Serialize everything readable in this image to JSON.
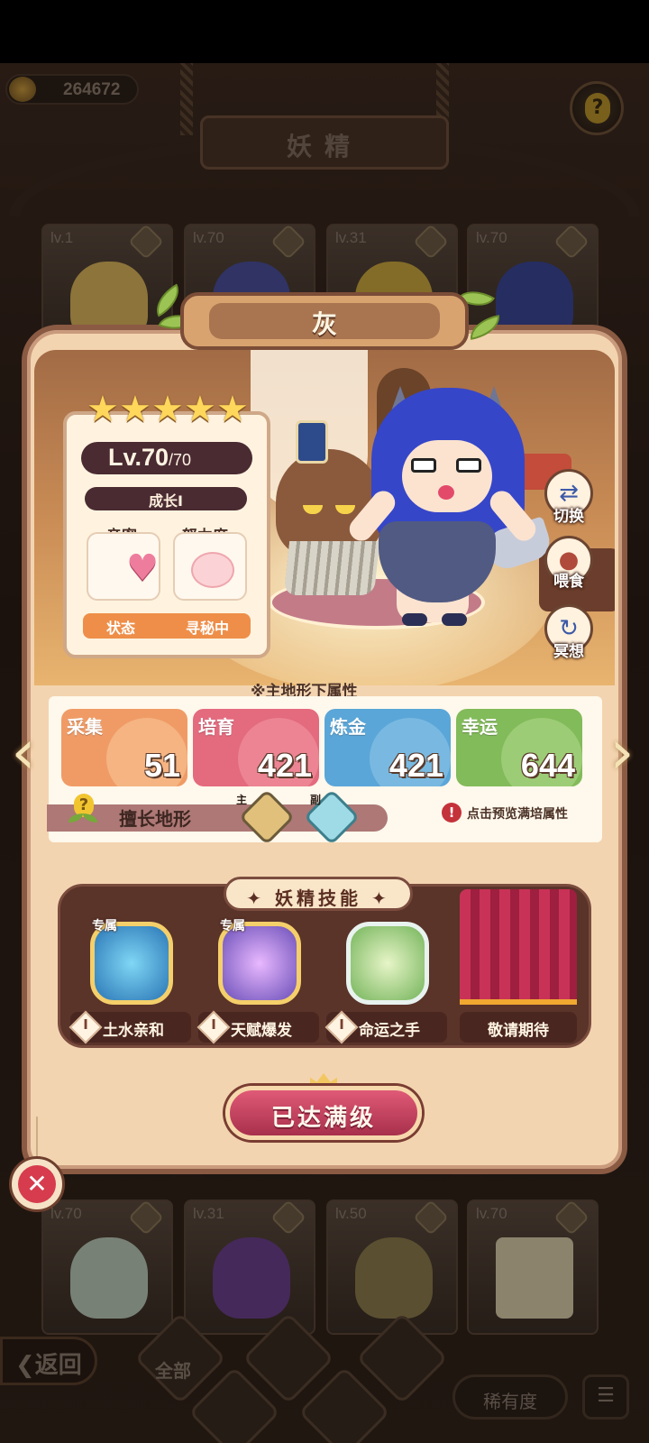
{
  "topbar": {
    "coins": "264672",
    "title": "妖精"
  },
  "background_fairies": [
    {
      "level": "lv.1"
    },
    {
      "level": "lv.70"
    },
    {
      "level": "lv.31"
    },
    {
      "level": "lv.70"
    },
    {
      "level": "lv.70"
    },
    {
      "level": "lv.31"
    },
    {
      "level": "lv.50"
    },
    {
      "level": "lv.70"
    }
  ],
  "fairy": {
    "name": "灰",
    "stars": 5,
    "level": "Lv.70",
    "level_max": "/70",
    "growth": "成长I",
    "intimacy_label": "亲密",
    "effort_label": "努力度",
    "status_label": "状态",
    "status_value": "寻秘中"
  },
  "side_actions": [
    {
      "label": "切换",
      "icon": "swap-icon"
    },
    {
      "label": "喂食",
      "icon": "meat-icon"
    },
    {
      "label": "冥想",
      "icon": "meditate-icon"
    }
  ],
  "attributes": {
    "section_title": "※主地形下属性",
    "items": [
      {
        "name": "采集",
        "value": "51",
        "color": "#f09b66"
      },
      {
        "name": "培育",
        "value": "421",
        "color": "#e46a7e"
      },
      {
        "name": "炼金",
        "value": "421",
        "color": "#5aa6d8"
      },
      {
        "name": "幸运",
        "value": "644",
        "color": "#82bb5a"
      }
    ],
    "terrain_label": "擅长地形",
    "main_tag": "主",
    "sub_tag": "副",
    "preview_note": "点击预览满培属性"
  },
  "skills": {
    "title": "妖精技能",
    "items": [
      {
        "name": "土水亲和",
        "tag": "专属",
        "rank": "I",
        "icon": "earth-water-swirl-icon"
      },
      {
        "name": "天赋爆发",
        "tag": "专属",
        "rank": "I",
        "icon": "talent-burst-icon"
      },
      {
        "name": "命运之手",
        "tag": "",
        "rank": "I",
        "icon": "clover-icon"
      }
    ],
    "locked_label": "敬请期待"
  },
  "max_level_button": "已达满级",
  "bottom": {
    "back": "返回",
    "all": "全部",
    "rarity": "稀有度"
  }
}
